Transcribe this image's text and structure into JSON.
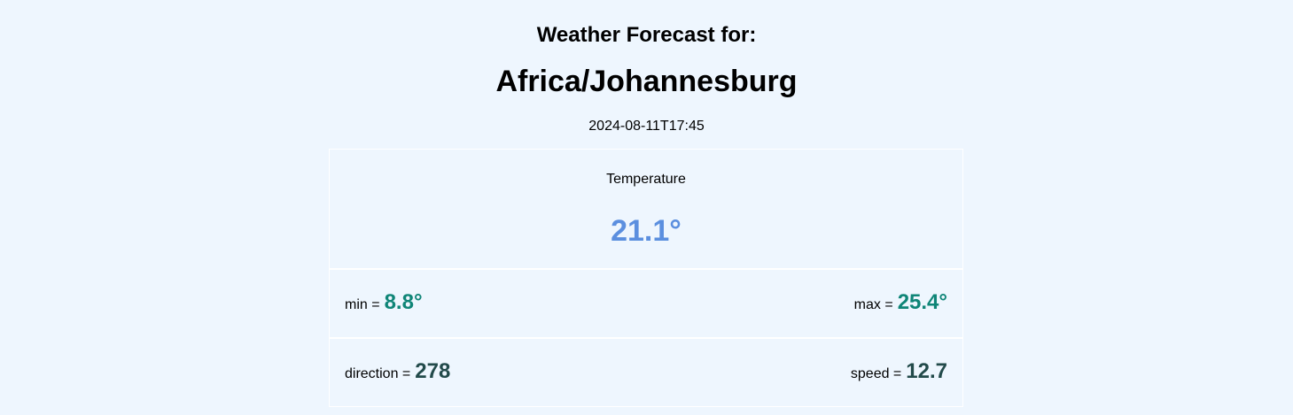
{
  "header": {
    "title": "Weather Forecast for:",
    "city": "Africa/Johannesburg",
    "timestamp": "2024-08-11T17:45"
  },
  "temperature": {
    "label": "Temperature",
    "current": "21.1°",
    "min_label": "min =",
    "min_value": "8.8°",
    "max_label": "max =",
    "max_value": "25.4°"
  },
  "wind": {
    "direction_label": "direction =",
    "direction_value": "278",
    "speed_label": "speed =",
    "speed_value": "12.7"
  },
  "colors": {
    "background": "#eef6fe",
    "current_temp": "#5b8fdf",
    "minmax": "#0f8577",
    "wind": "#224a4a"
  }
}
